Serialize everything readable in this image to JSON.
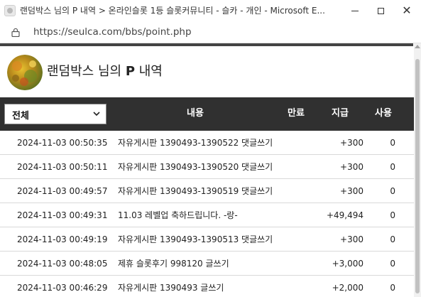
{
  "window": {
    "title": "랜덤박스 님의 P 내역 > 온라인슬롯 1등 슬롯커뮤니티 - 슬카 - 개인 - Microsoft E...",
    "controls": {
      "minimize": "",
      "maximize": "",
      "close": "✕"
    }
  },
  "address_bar": {
    "url": "https://seulca.com/bbs/point.php"
  },
  "page": {
    "title_prefix": "랜덤박스 님의 ",
    "title_p": "P",
    "title_suffix": " 내역"
  },
  "table": {
    "filter": {
      "selected": "전체"
    },
    "headers": {
      "content": "내용",
      "expire": "만료",
      "grant": "지급",
      "use": "사용"
    },
    "rows": [
      {
        "date": "2024-11-03 00:50:35",
        "content": "자유게시판 1390493-1390522 댓글쓰기",
        "grant": "+300",
        "use": "0"
      },
      {
        "date": "2024-11-03 00:50:11",
        "content": "자유게시판 1390493-1390520 댓글쓰기",
        "grant": "+300",
        "use": "0"
      },
      {
        "date": "2024-11-03 00:49:57",
        "content": "자유게시판 1390493-1390519 댓글쓰기",
        "grant": "+300",
        "use": "0"
      },
      {
        "date": "2024-11-03 00:49:31",
        "content": "11.03 레벨업 축하드립니다. -랑-",
        "grant": "+49,494",
        "use": "0"
      },
      {
        "date": "2024-11-03 00:49:19",
        "content": "자유게시판 1390493-1390513 댓글쓰기",
        "grant": "+300",
        "use": "0"
      },
      {
        "date": "2024-11-03 00:48:05",
        "content": "제휴 슬롯후기 998120 글쓰기",
        "grant": "+3,000",
        "use": "0"
      },
      {
        "date": "2024-11-03 00:46:29",
        "content": "자유게시판 1390493 글쓰기",
        "grant": "+2,000",
        "use": "0"
      }
    ]
  },
  "colors": {
    "header_bg": "#303030",
    "top_line": "#444444"
  }
}
